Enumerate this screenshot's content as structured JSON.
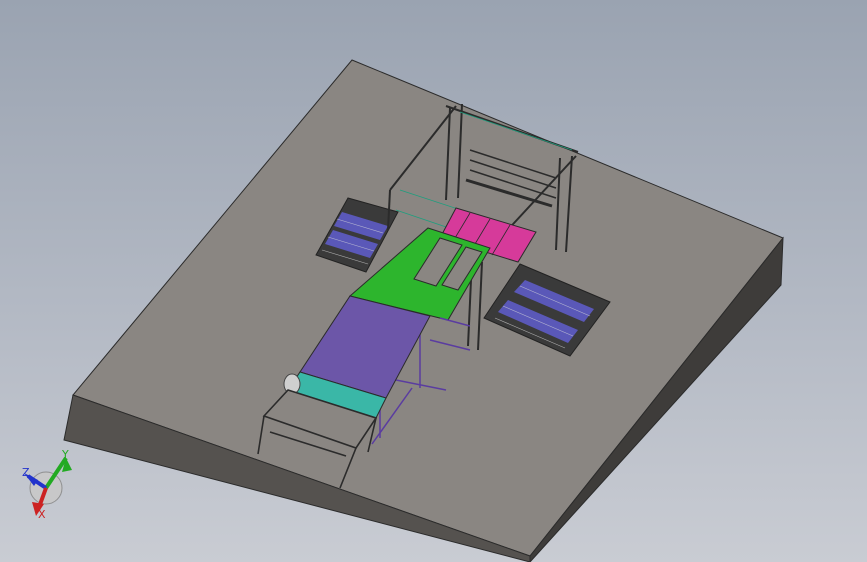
{
  "triad": {
    "z_label": "Z",
    "y_label": "Y",
    "x_label": "X",
    "colors": {
      "x": "#cc2222",
      "y": "#22aa22",
      "z": "#2233cc"
    }
  },
  "colors": {
    "viewport_top": "#9aa3b1",
    "viewport_bottom": "#c9ccd3",
    "base_top": "#8a8682",
    "base_front": "#55524f",
    "base_side": "#3e3c3a",
    "infeed_belt": "#6c56a8",
    "transfer_table": "#2db52d",
    "pick_zone": "#d63a9a",
    "roller_cover": "#3ab7a7",
    "side_conveyor_rails": "#5a58b8",
    "frame_lines": "#2b2b2b"
  }
}
